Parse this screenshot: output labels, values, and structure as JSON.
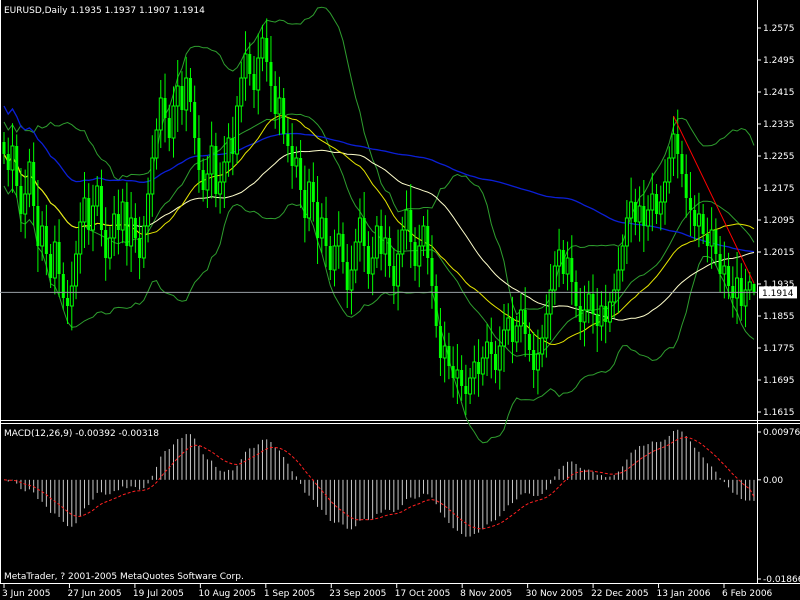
{
  "window": {
    "symbol_header": "EURUSD,Daily  1.1935 1.1937 1.1907 1.1914",
    "macd_header": "MACD(12,26,9) -0.00392 -0.00318",
    "copyright": "MetaTrader, ? 2001-2005 MetaQuotes Software Corp.",
    "current_price": "1.1914"
  },
  "colors": {
    "background": "#000000",
    "candle": "#00ff00",
    "bollinger": "#2e9e2e",
    "ma_yellow": "#e6e600",
    "ma_white": "#ffffcc",
    "ma_blue": "#0b1fd6",
    "trendline": "#ff0000",
    "price_line": "#9aa0a6",
    "macd_hist": "#c8c8c8",
    "macd_signal": "#ff2020",
    "text": "#ffffff"
  },
  "chart_data": [
    {
      "type": "candlestick",
      "title": "EURUSD,Daily",
      "x_tick_labels": [
        "3 Jun 2005",
        "27 Jun 2005",
        "19 Jul 2005",
        "10 Aug 2005",
        "1 Sep 2005",
        "23 Sep 2005",
        "17 Oct 2005",
        "8 Nov 2005",
        "30 Nov 2005",
        "22 Dec 2005",
        "13 Jan 2006",
        "6 Feb 2006"
      ],
      "y_tick_labels": [
        "1.2575",
        "1.2495",
        "1.2415",
        "1.2335",
        "1.2255",
        "1.2175",
        "1.2095",
        "1.2015",
        "1.1935",
        "1.1855",
        "1.1775",
        "1.1695",
        "1.1615"
      ],
      "ylim": [
        1.1605,
        1.26
      ],
      "last": {
        "open": 1.1935,
        "high": 1.1937,
        "low": 1.1907,
        "close": 1.1914
      },
      "close_series": [
        1.226,
        1.222,
        1.228,
        1.218,
        1.211,
        1.216,
        1.224,
        1.213,
        1.203,
        1.208,
        1.201,
        1.195,
        1.204,
        1.196,
        1.19,
        1.188,
        1.193,
        1.201,
        1.209,
        1.215,
        1.207,
        1.213,
        1.218,
        1.207,
        1.2,
        1.205,
        1.211,
        1.207,
        1.214,
        1.203,
        1.21,
        1.205,
        1.2,
        1.208,
        1.216,
        1.225,
        1.232,
        1.24,
        1.235,
        1.23,
        1.238,
        1.243,
        1.237,
        1.245,
        1.239,
        1.23,
        1.222,
        1.217,
        1.221,
        1.228,
        1.216,
        1.219,
        1.224,
        1.23,
        1.226,
        1.238,
        1.245,
        1.251,
        1.246,
        1.242,
        1.25,
        1.255,
        1.249,
        1.243,
        1.236,
        1.24,
        1.231,
        1.228,
        1.223,
        1.225,
        1.217,
        1.21,
        1.219,
        1.214,
        1.205,
        1.21,
        1.203,
        1.197,
        1.203,
        1.206,
        1.199,
        1.192,
        1.197,
        1.204,
        1.21,
        1.203,
        1.196,
        1.2,
        1.208,
        1.201,
        1.205,
        1.198,
        1.193,
        1.201,
        1.207,
        1.212,
        1.204,
        1.198,
        1.203,
        1.208,
        1.2,
        1.193,
        1.183,
        1.175,
        1.178,
        1.173,
        1.17,
        1.172,
        1.168,
        1.166,
        1.17,
        1.174,
        1.171,
        1.175,
        1.179,
        1.176,
        1.172,
        1.178,
        1.182,
        1.185,
        1.179,
        1.183,
        1.187,
        1.181,
        1.177,
        1.172,
        1.176,
        1.18,
        1.186,
        1.192,
        1.198,
        1.202,
        1.196,
        1.2,
        1.194,
        1.188,
        1.184,
        1.187,
        1.191,
        1.186,
        1.183,
        1.188,
        1.184,
        1.189,
        1.192,
        1.197,
        1.203,
        1.21,
        1.214,
        1.209,
        1.213,
        1.208,
        1.212,
        1.216,
        1.211,
        1.214,
        1.219,
        1.225,
        1.231,
        1.226,
        1.221,
        1.215,
        1.212,
        1.208,
        1.211,
        1.206,
        1.203,
        1.207,
        1.201,
        1.196,
        1.198,
        1.193,
        1.19,
        1.195,
        1.188,
        1.192,
        1.194,
        1.191
      ]
    },
    {
      "type": "bar",
      "title": "MACD(12,26,9)",
      "y_tick_labels": [
        "0.00976",
        "0.00",
        "-0.01866"
      ],
      "ylim": [
        -0.0188,
        0.01
      ],
      "last": {
        "macd": -0.00392,
        "signal": -0.00318
      }
    }
  ]
}
